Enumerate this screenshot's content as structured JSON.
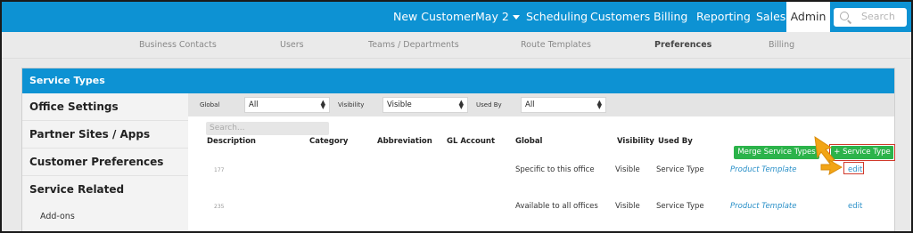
{
  "topnav": {
    "items": [
      {
        "label": "New Customer"
      },
      {
        "label": "May 2"
      },
      {
        "label": "Scheduling"
      },
      {
        "label": "Customers"
      },
      {
        "label": "Billing"
      },
      {
        "label": "Reporting"
      },
      {
        "label": "Sales"
      }
    ],
    "active": "Admin",
    "search_placeholder": "Search",
    "search_icon": "magnifier-icon",
    "colors": {
      "bar": "#0d92d3",
      "button_green": "#2bb34a",
      "highlight_red": "#d13a2c",
      "link_blue": "#2a90c8"
    }
  },
  "subnav": {
    "items": [
      {
        "label": "Business Contacts"
      },
      {
        "label": "Users"
      },
      {
        "label": "Teams / Departments"
      },
      {
        "label": "Route Templates"
      },
      {
        "label": "Preferences"
      },
      {
        "label": "Billing"
      }
    ],
    "active": "Preferences"
  },
  "panel": {
    "title": "Service Types"
  },
  "sidebar": {
    "items": [
      {
        "label": "Office Settings"
      },
      {
        "label": "Partner Sites / Apps"
      },
      {
        "label": "Customer Preferences"
      },
      {
        "label": "Service Related"
      }
    ],
    "sub_items": [
      {
        "label": "Add-ons"
      }
    ]
  },
  "filters": {
    "global_label": "Global",
    "global_value": "All",
    "visibility_label": "Visibility",
    "visibility_value": "Visible",
    "usedby_label": "Used By",
    "usedby_value": "All"
  },
  "table": {
    "search_placeholder": "Search...",
    "merge_button": "Merge Service Types",
    "add_button": "+ Service Type",
    "columns": [
      "Description",
      "Category",
      "Abbreviation",
      "GL Account",
      "Global",
      "Visibility",
      "Used By"
    ],
    "rows": [
      {
        "id": "177",
        "global": "Specific to this office",
        "visibility": "Visible",
        "used_by": "Service Type",
        "template": "Product Template",
        "edit": "edit"
      },
      {
        "id": "235",
        "global": "Available to all offices",
        "visibility": "Visible",
        "used_by": "Service Type",
        "template": "Product Template",
        "edit": "edit"
      }
    ]
  }
}
